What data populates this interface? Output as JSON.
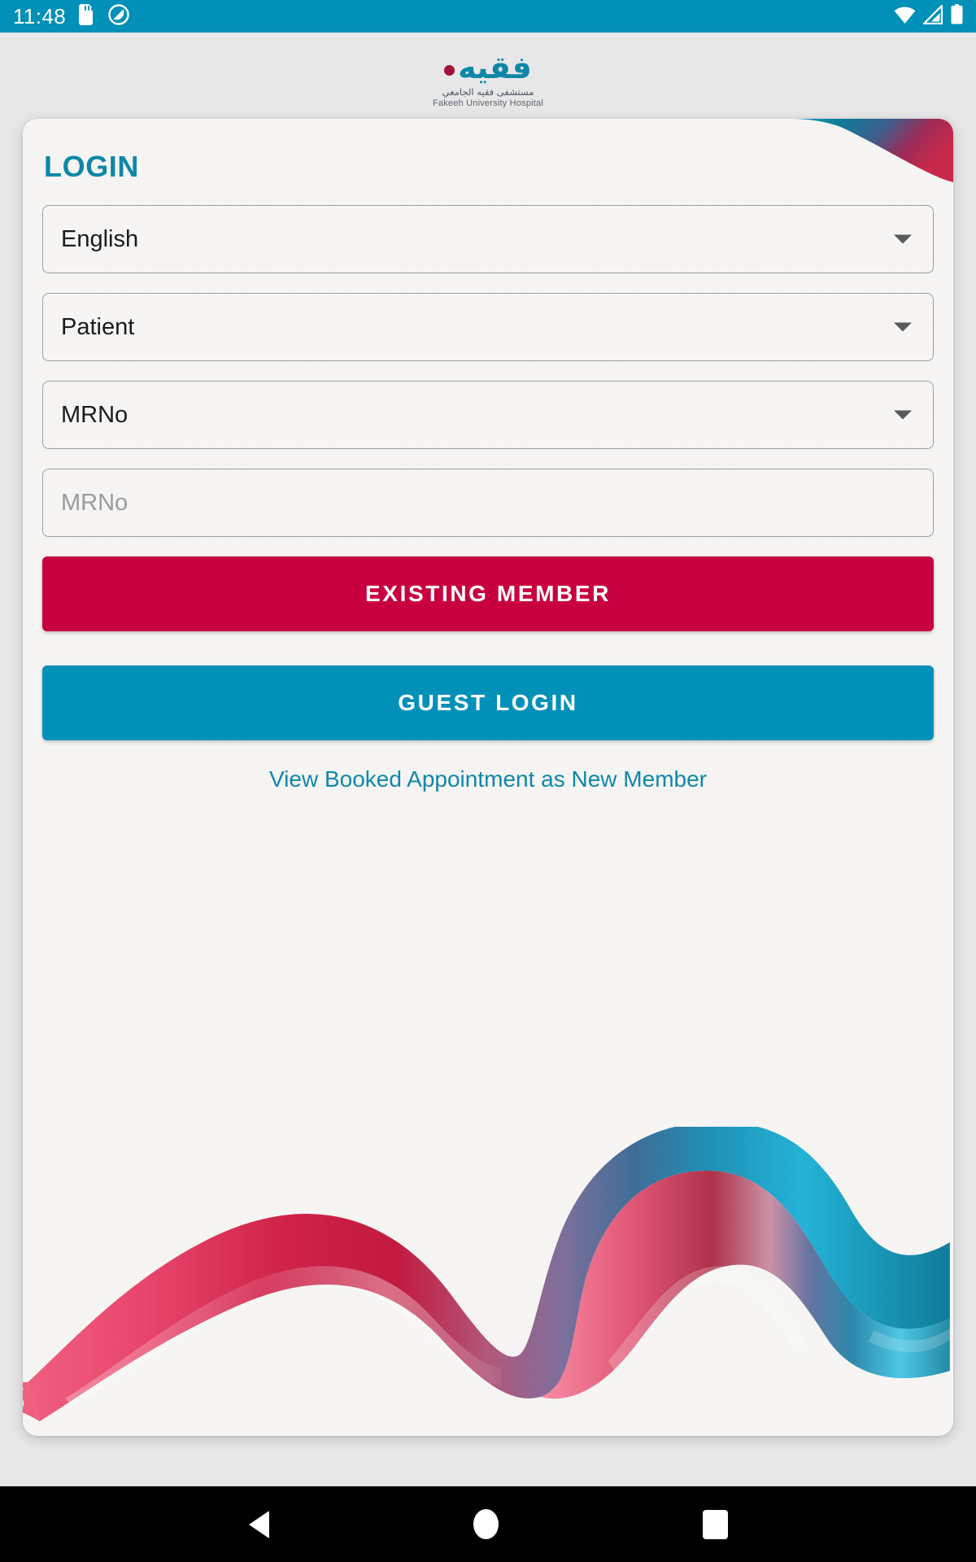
{
  "status_bar": {
    "time": "11:48",
    "background_color": "#0090B8",
    "left_icons": [
      "sd-card-icon",
      "do-not-disturb-icon"
    ],
    "right_icons": [
      "wifi-icon",
      "cellular-signal-icon",
      "battery-icon"
    ]
  },
  "logo": {
    "arabic_wordmark": "فقيه",
    "arabic_subtitle": "مستشفى فقيه الجامعي",
    "english_subtitle": "Fakeeh University Hospital",
    "brand_teal": "#0D87A8",
    "brand_crimson": "#A3123A"
  },
  "card": {
    "title": "LOGIN",
    "title_color": "#0D87A8",
    "background_color": "#F7F6F4"
  },
  "form": {
    "fields": [
      {
        "name": "language-select",
        "value": "English",
        "type": "dropdown"
      },
      {
        "name": "user-type-select",
        "value": "Patient",
        "type": "dropdown"
      },
      {
        "name": "id-type-select",
        "value": "MRNo",
        "type": "dropdown"
      },
      {
        "name": "mrno-input",
        "placeholder": "MRNo",
        "value": "",
        "type": "text"
      }
    ]
  },
  "actions": {
    "existing_member_label": "EXISTING MEMBER",
    "existing_member_color": "#C80041",
    "guest_login_label": "GUEST LOGIN",
    "guest_login_color": "#0090B8",
    "view_booked_link": "View Booked Appointment as New Member",
    "link_color": "#0F87AB"
  },
  "decoration": {
    "ribbon_colors": [
      "#E8456B",
      "#C21A3E",
      "#8E6A8E",
      "#3D6E96",
      "#1E9BC4",
      "#0E7C99"
    ]
  },
  "nav_bar": {
    "items": [
      "back-button",
      "home-button",
      "recents-button"
    ],
    "background_color": "#000000"
  }
}
